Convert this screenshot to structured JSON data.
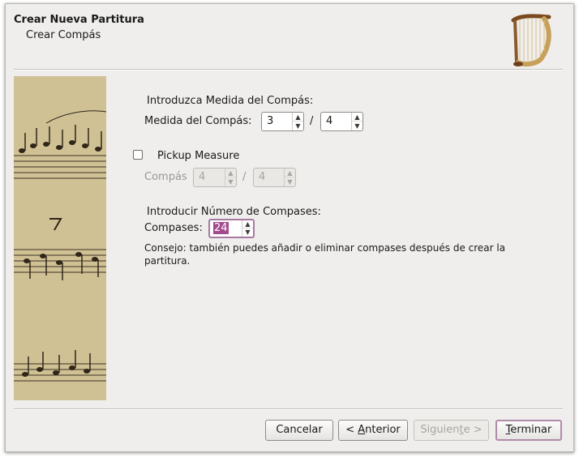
{
  "header": {
    "title": "Crear Nueva Partitura",
    "subtitle": "Crear Compás"
  },
  "time_signature": {
    "section_label": "Introduzca Medida del Compás:",
    "field_label": "Medida del Compás:",
    "numerator": "3",
    "slash": "/",
    "denominator": "4"
  },
  "pickup": {
    "checkbox_label": "Pickup Measure",
    "checked": false,
    "field_label": "Compás",
    "numerator": "4",
    "slash": "/",
    "denominator": "4"
  },
  "measures": {
    "section_label": "Introducir Número de Compases:",
    "field_label": "Compases:",
    "value": "24",
    "hint": "Consejo: también puedes añadir o eliminar compases después de crear la partitura."
  },
  "buttons": {
    "cancel": "Cancelar",
    "back_prefix": "< ",
    "back_mnemonic": "A",
    "back_rest": "nterior",
    "next_prefix": "Siguien",
    "next_mnemonic": "t",
    "next_rest": "e >",
    "finish_mnemonic": "T",
    "finish_rest": "erminar"
  },
  "colors": {
    "window_bg": "#efeeec",
    "selection": "#a24a8c",
    "focus_border": "#a67aa0"
  },
  "icons": [
    "harp-logo-icon",
    "spin-up-arrow-icon",
    "spin-down-arrow-icon"
  ]
}
